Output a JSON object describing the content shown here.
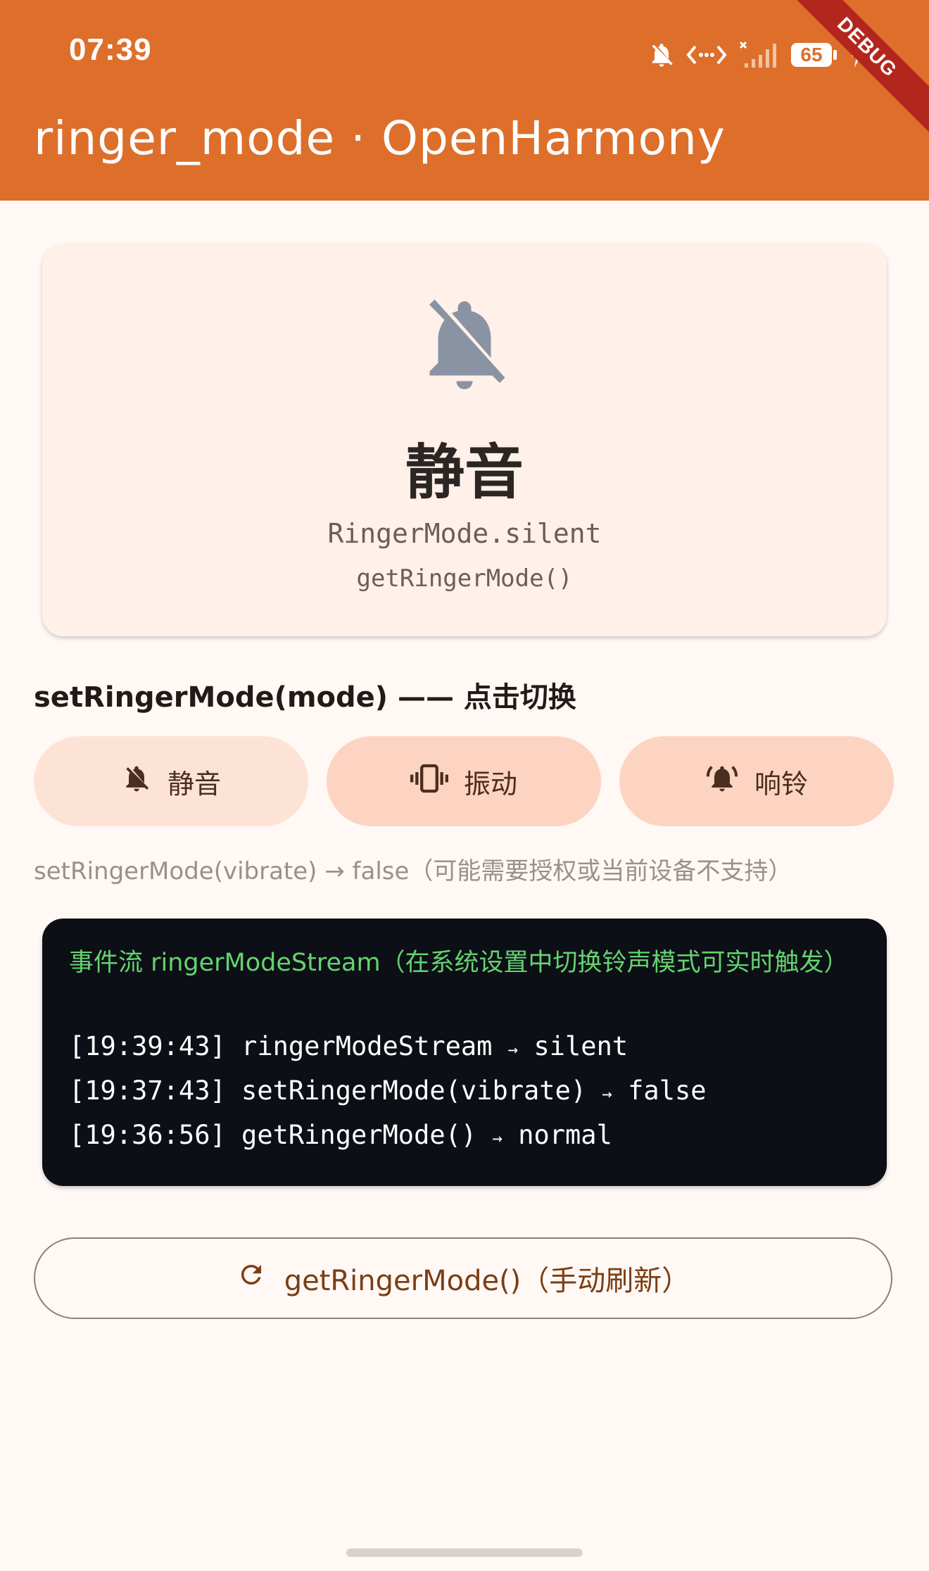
{
  "status_bar": {
    "time": "07:39",
    "battery": "65",
    "icons": [
      "bell-off-icon",
      "data-transfer-icon",
      "signal-icon",
      "battery-icon",
      "charging-icon"
    ]
  },
  "app_bar": {
    "title": "ringer_mode · OpenHarmony",
    "debug_label": "DEBUG",
    "background_color": "#dd6f2b"
  },
  "current_mode": {
    "icon": "bell-off-icon",
    "name": "静音",
    "enum_value": "RingerMode.silent",
    "api_call": "getRingerMode()"
  },
  "set_mode": {
    "title": "setRingerMode(mode) —— 点击切换",
    "buttons": [
      {
        "icon": "bell-off-icon",
        "label": "静音"
      },
      {
        "icon": "vibrate-icon",
        "label": "振动"
      },
      {
        "icon": "ringing-bell-icon",
        "label": "响铃"
      }
    ],
    "result_text": "setRingerMode(vibrate) → false（可能需要授权或当前设备不支持）"
  },
  "event_log": {
    "header": "事件流 ringerModeStream（在系统设置中切换铃声模式可实时触发）",
    "entries": [
      {
        "time": "[19:39:43]",
        "message": "ringerModeStream",
        "arrow": "→",
        "value": "silent"
      },
      {
        "time": "[19:37:43]",
        "message": "setRingerMode(vibrate)",
        "arrow": "→",
        "value": "false"
      },
      {
        "time": "[19:36:56]",
        "message": "getRingerMode()",
        "arrow": "→",
        "value": "normal"
      }
    ],
    "accent_color": "#64d36e"
  },
  "refresh_button": {
    "icon": "refresh-icon",
    "label": "getRingerMode()（手动刷新）"
  }
}
